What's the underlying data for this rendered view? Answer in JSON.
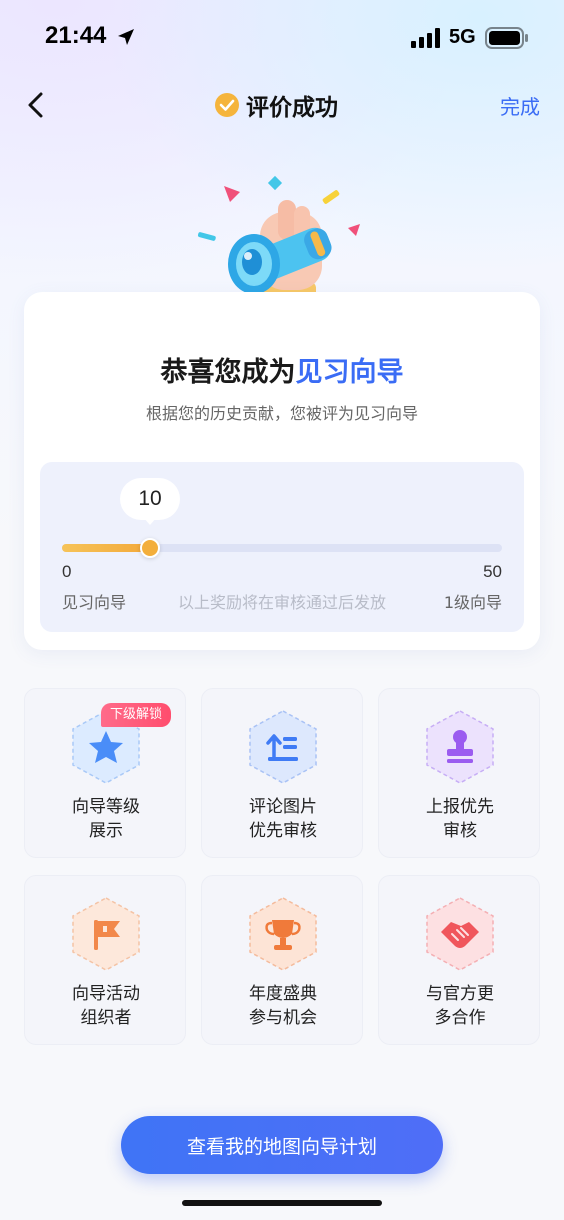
{
  "status_bar": {
    "time": "21:44",
    "network": "5G"
  },
  "nav": {
    "title": "评价成功",
    "done_label": "完成"
  },
  "card": {
    "headline_prefix": "恭喜您成为",
    "headline_highlight": "见习向导",
    "subline": "根据您的历史贡献，您被评为见习向导",
    "progress": {
      "current": "10",
      "current_value": 10,
      "min": "0",
      "max": "50",
      "min_value": 0,
      "max_value": 50,
      "min_label": "见习向导",
      "max_label": "1级向导",
      "note": "以上奖励将在审核通过后发放"
    }
  },
  "privileges": [
    {
      "label": "向导等级\n展示",
      "icon": "star-icon",
      "badge": "下级解锁",
      "color": "#4a8df8"
    },
    {
      "label": "评论图片\n优先审核",
      "icon": "priority-up-icon",
      "badge": "",
      "color": "#3f7bf5"
    },
    {
      "label": "上报优先\n审核",
      "icon": "stamp-icon",
      "badge": "",
      "color": "#9b5cf0"
    },
    {
      "label": "向导活动\n组织者",
      "icon": "flag-icon",
      "badge": "",
      "color": "#f2884a"
    },
    {
      "label": "年度盛典\n参与机会",
      "icon": "trophy-icon",
      "badge": "",
      "color": "#f07a3a"
    },
    {
      "label": "与官方更\n多合作",
      "icon": "handshake-icon",
      "badge": "",
      "color": "#f0565c"
    }
  ],
  "cta_label": "查看我的地图向导计划"
}
